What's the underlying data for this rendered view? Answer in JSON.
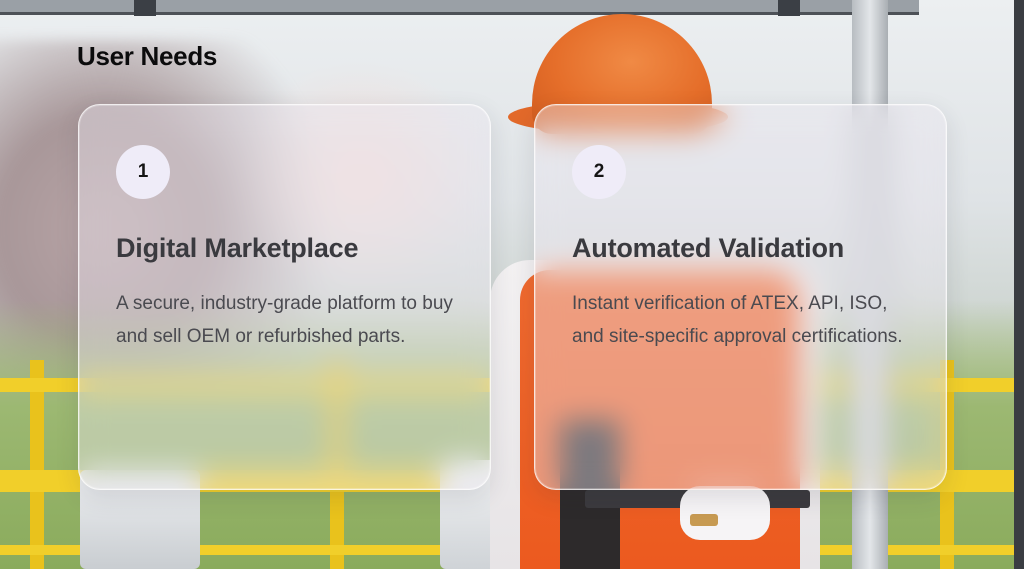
{
  "slide": {
    "title": "User Needs",
    "cards": [
      {
        "number": "1",
        "title": "Digital Marketplace",
        "description": "A secure, industry-grade platform to buy and sell OEM or refurbished parts."
      },
      {
        "number": "2",
        "title": "Automated Validation",
        "description": "Instant verification of ATEX, API, ISO, and site-specific approval certifications."
      }
    ]
  },
  "colors": {
    "title_text": "#0b0b0c",
    "card_title_text": "#3a3a3f",
    "card_desc_text": "#4a4a50",
    "badge_bg": "#efecf8",
    "helmet_orange": "#e56e2a",
    "railing_yellow": "#f1cf2a"
  }
}
